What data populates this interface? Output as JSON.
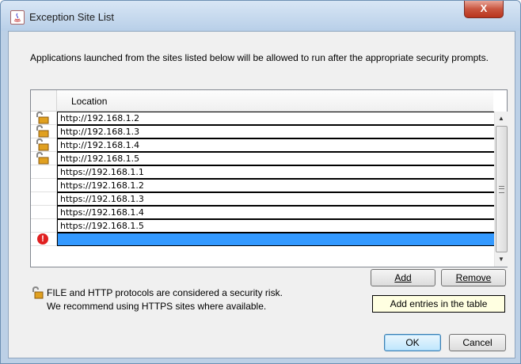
{
  "window": {
    "title": "Exception Site List",
    "close_label": "X"
  },
  "description": "Applications launched from the sites listed below will be allowed to run after the appropriate security prompts.",
  "table": {
    "column_header": "Location",
    "rows": [
      {
        "url": "http://192.168.1.2",
        "icon": "unlocked-padlock-icon"
      },
      {
        "url": "http://192.168.1.3",
        "icon": "unlocked-padlock-icon"
      },
      {
        "url": "http://192.168.1.4",
        "icon": "unlocked-padlock-icon"
      },
      {
        "url": "http://192.168.1.5",
        "icon": "unlocked-padlock-icon"
      },
      {
        "url": "https://192.168.1.1",
        "icon": ""
      },
      {
        "url": "https://192.168.1.2",
        "icon": ""
      },
      {
        "url": "https://192.168.1.3",
        "icon": ""
      },
      {
        "url": "https://192.168.1.4",
        "icon": ""
      },
      {
        "url": "https://192.168.1.5",
        "icon": ""
      },
      {
        "url": "",
        "icon": "error-icon",
        "selected": true
      }
    ],
    "error_glyph": "!"
  },
  "buttons": {
    "add": "Add",
    "remove": "Remove",
    "ok": "OK",
    "cancel": "Cancel"
  },
  "warning": {
    "line1": "FILE and HTTP protocols are considered a security risk.",
    "line2": "We recommend using HTTPS sites where available."
  },
  "tooltip": "Add entries in the table",
  "colors": {
    "selection": "#3399ff",
    "error": "#e02020",
    "tooltip_bg": "#ffffe1"
  }
}
